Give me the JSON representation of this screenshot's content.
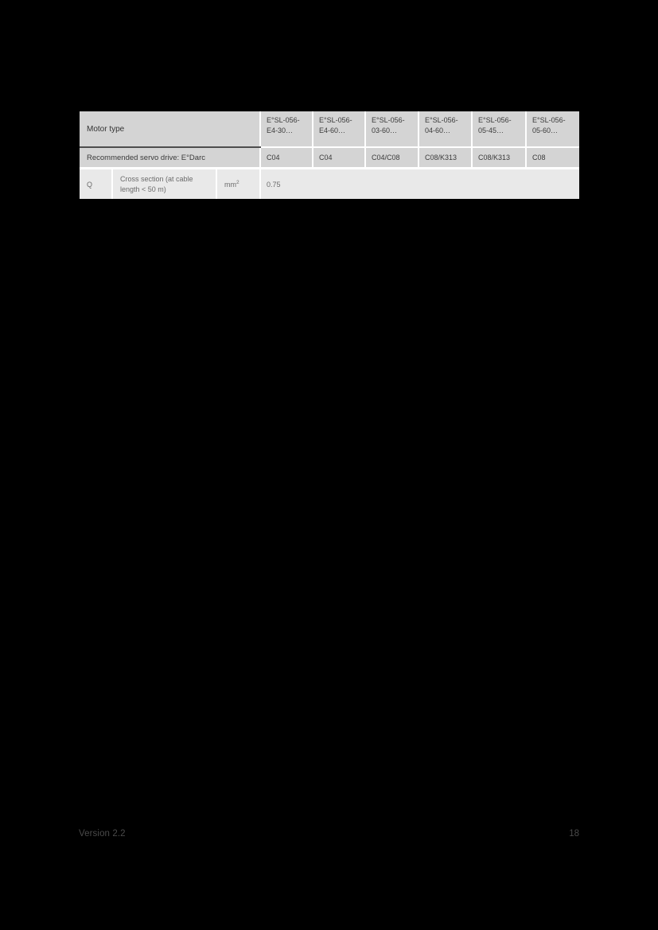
{
  "document": {
    "page_background": "#000000",
    "table_header_bg": "#d4d4d4",
    "table_row_bg": "#e9e9e9",
    "text_color": "#3a3a3a"
  },
  "table": {
    "row_label_motor_type": "Motor type",
    "row_label_servo_drive": "Recommended servo drive: E°Darc",
    "motor_columns": [
      "E°SL-056-E4-30…",
      "E°SL-056-E4-60…",
      "E°SL-056-03-60…",
      "E°SL-056-04-60…",
      "E°SL-056-05-45…",
      "E°SL-056-05-60…"
    ],
    "motor_columns_line1": [
      "E°SL-056-",
      "E°SL-056-",
      "E°SL-056-",
      "E°SL-056-",
      "E°SL-056-",
      "E°SL-056-"
    ],
    "motor_columns_line2": [
      "E4-30…",
      "E4-60…",
      "03-60…",
      "04-60…",
      "05-45…",
      "05-60…"
    ],
    "servo_drive_values": [
      "C04",
      "C04",
      "C04/C08",
      "C08/K313",
      "C08/K313",
      "C08"
    ],
    "cross_section_row": {
      "symbol": "Q",
      "description": "Cross section (at cable length < 50 m)",
      "description_line1": "Cross section (at cable",
      "description_line2": "length < 50 m)",
      "unit_base": "mm",
      "unit_exponent": "2",
      "value": "0.75"
    }
  },
  "footer": {
    "version": "Version 2.2",
    "page_number": "18"
  }
}
